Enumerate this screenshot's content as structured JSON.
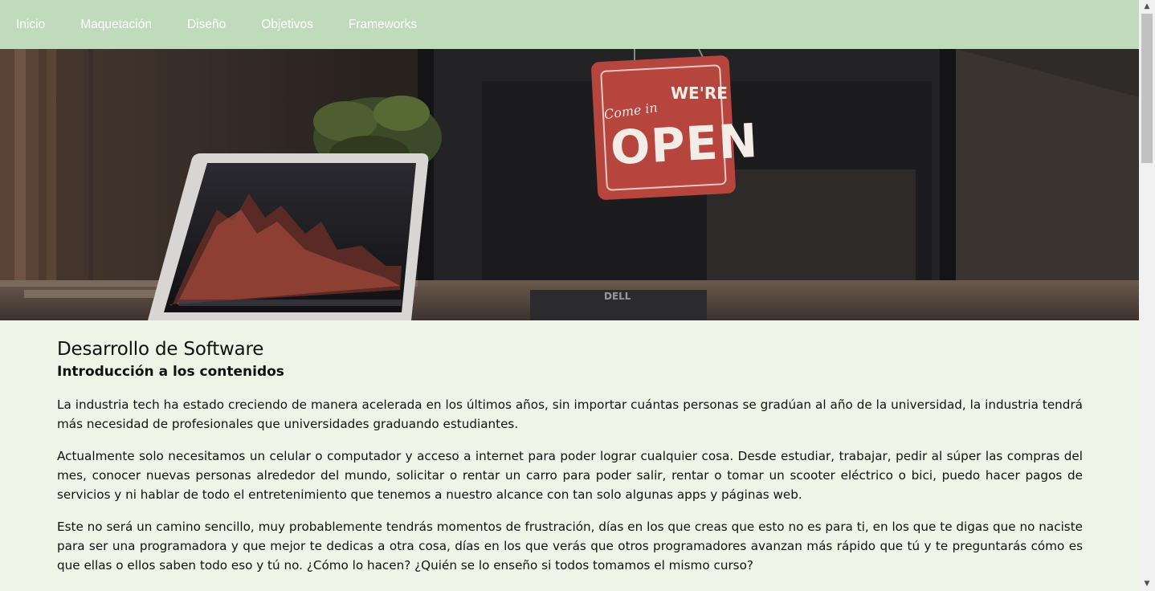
{
  "nav": {
    "items": [
      {
        "label": "Inicio"
      },
      {
        "label": "Maquetación"
      },
      {
        "label": "Diseño"
      },
      {
        "label": "Objetivos"
      },
      {
        "label": "Frameworks"
      }
    ]
  },
  "hero": {
    "sign_script": "Come in",
    "sign_top": "WE'RE",
    "sign_main": "OPEN",
    "monitor_brand": "DELL"
  },
  "content": {
    "title": "Desarrollo de Software",
    "subtitle": "Introducción a los contenidos",
    "paragraphs": [
      "La industria tech ha estado creciendo de manera acelerada en los últimos años, sin importar cuántas personas se gradúan al año de la universidad, la industria tendrá más necesidad de profesionales que universidades graduando estudiantes.",
      "Actualmente solo necesitamos un celular o computador y acceso a internet para poder lograr cualquier cosa. Desde estudiar, trabajar, pedir al súper las compras del mes, conocer nuevas personas alrededor del mundo, solicitar o rentar un carro para poder salir, rentar o tomar un scooter eléctrico o bici, puedo hacer pagos de servicios y ni hablar de todo el entretenimiento que tenemos a nuestro alcance con tan solo algunas apps y páginas web.",
      "Este no será un camino sencillo, muy probablemente tendrás momentos de frustración, días en los que creas que esto no es para ti, en los que te digas que no naciste para ser una programadora y que mejor te dedicas a otra cosa, días en los que verás que otros programadores avanzan más rápido que tú y te preguntarás cómo es que ellas o ellos saben todo eso y tú no. ¿Cómo lo hacen? ¿Quién se lo enseño si todos tomamos el mismo curso?"
    ]
  },
  "scrollbar": {
    "up_icon": "chevron-up-icon",
    "down_icon": "chevron-down-icon"
  },
  "colors": {
    "nav_bg": "#c0dbbc",
    "page_bg": "#eef5e6",
    "sign_red": "#b5453d"
  }
}
